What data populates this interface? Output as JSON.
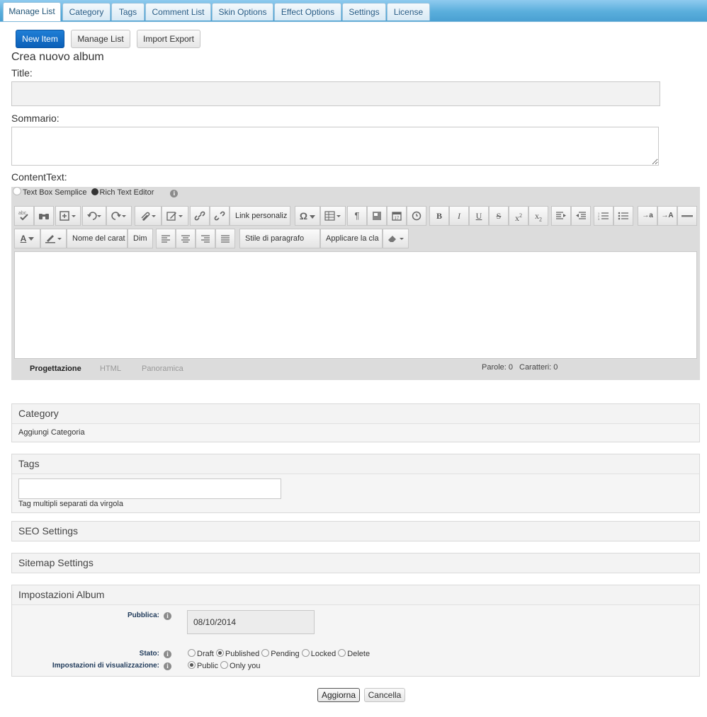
{
  "tabs": [
    "Manage List",
    "Category",
    "Tags",
    "Comment List",
    "Skin Options",
    "Effect Options",
    "Settings",
    "License"
  ],
  "subnav": {
    "new_item": "New Item",
    "manage_list": "Manage List",
    "import_export": "Import Export"
  },
  "heading": "Crea nuovo album",
  "title_label": "Title:",
  "title_value": "",
  "summary_label": "Sommario:",
  "summary_value": "",
  "content_label": "ContentText:",
  "editor_mode": {
    "simple": "Text Box Semplice",
    "rich": "Rich Text Editor",
    "selected": "rich"
  },
  "toolbar": {
    "custom_link": "Link personaliz",
    "font_name": "Nome del carat",
    "font_size": "Dim",
    "paragraph_style": "Stile di paragrafo",
    "apply_class": "Applicare la cla"
  },
  "editor_footer": {
    "design": "Progettazione",
    "html": "HTML",
    "preview": "Panoramica",
    "words": "Parole: 0",
    "chars": "Caratteri: 0"
  },
  "category": {
    "title": "Category",
    "link": "Aggiungi Categoria"
  },
  "tags": {
    "title": "Tags",
    "value": "",
    "hint": "Tag multipli separati da virgola"
  },
  "seo": {
    "title": "SEO Settings"
  },
  "sitemap": {
    "title": "Sitemap Settings"
  },
  "album": {
    "title": "Impostazioni Album",
    "publish_label": "Pubblica:",
    "publish_value": "08/10/2014",
    "status_label": "Stato:",
    "status_options": [
      "Draft",
      "Published",
      "Pending",
      "Locked",
      "Delete"
    ],
    "status_selected": "Published",
    "visibility_label": "Impostazioni di visualizzazione:",
    "visibility_options": [
      "Public",
      "Only you"
    ],
    "visibility_selected": "Public"
  },
  "actions": {
    "update": "Aggiorna",
    "cancel": "Cancella"
  },
  "colors": {
    "primary": "#0b5fb8",
    "tabbar": "#5aaedc",
    "label_navy": "#1f3a5a"
  }
}
